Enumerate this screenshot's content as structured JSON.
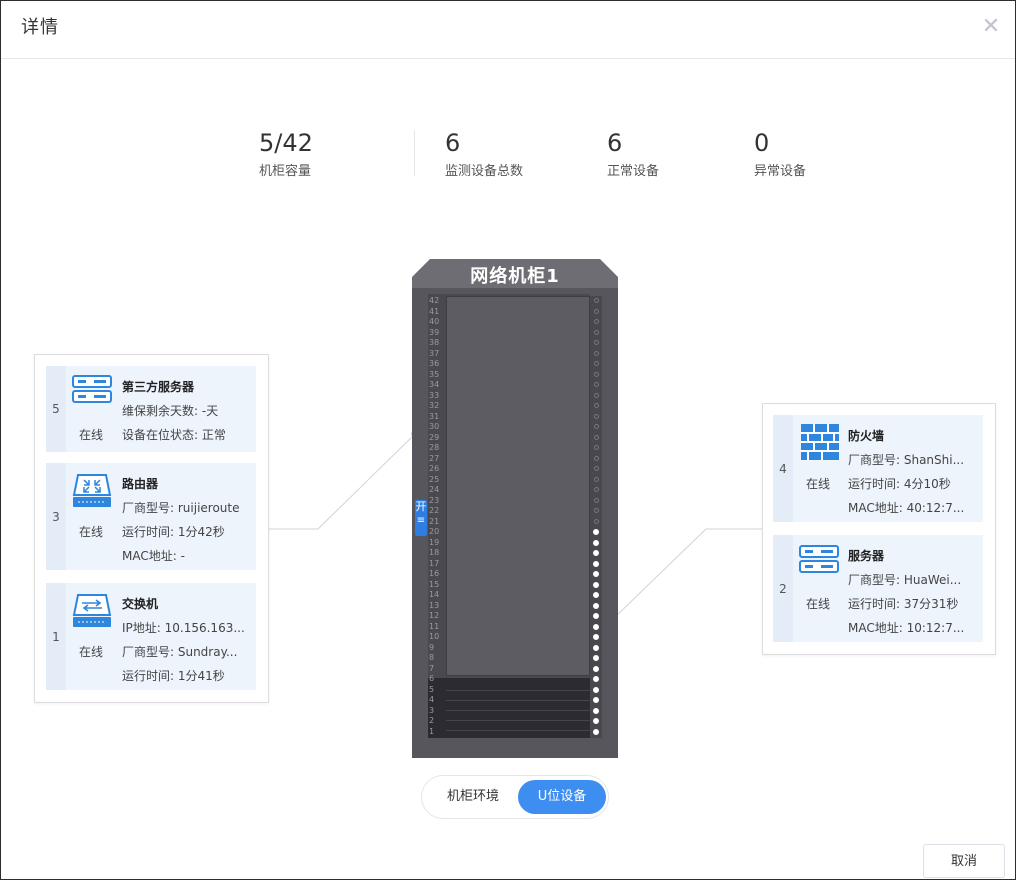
{
  "dialog": {
    "title": "详情",
    "close_icon": "close-icon",
    "cancel_label": "取消"
  },
  "stats": [
    {
      "value": "5/42",
      "label": "机柜容量"
    },
    {
      "value": "6",
      "label": "监测设备总数"
    },
    {
      "value": "6",
      "label": "正常设备"
    },
    {
      "value": "0",
      "label": "异常设备"
    }
  ],
  "cabinet": {
    "name": "网络机柜1",
    "side_button": "开",
    "side_icon": "list-icon",
    "units": [
      "42",
      "41",
      "40",
      "39",
      "38",
      "37",
      "36",
      "35",
      "34",
      "33",
      "32",
      "31",
      "30",
      "29",
      "28",
      "27",
      "26",
      "25",
      "24",
      "23",
      "22",
      "21",
      "20",
      "19",
      "18",
      "17",
      "16",
      "15",
      "14",
      "13",
      "12",
      "11",
      "10",
      "9",
      "8",
      "7",
      "6",
      "5",
      "4",
      "3",
      "2",
      "1"
    ]
  },
  "left_devices": [
    {
      "index": "5",
      "icon": "server-icon",
      "name": "第三方服务器",
      "status": "在线",
      "lines": [
        "维保剩余天数: -天",
        "设备在位状态: 正常"
      ]
    },
    {
      "index": "3",
      "icon": "router-icon",
      "name": "路由器",
      "status": "在线",
      "lines": [
        "厂商型号: ruijieroute",
        "运行时间: 1分42秒",
        "MAC地址: -"
      ]
    },
    {
      "index": "1",
      "icon": "switch-icon",
      "name": "交换机",
      "status": "在线",
      "lines": [
        "IP地址: 10.156.163...",
        "厂商型号: Sundray...",
        "运行时间: 1分41秒"
      ]
    }
  ],
  "right_devices": [
    {
      "index": "4",
      "icon": "firewall-icon",
      "name": "防火墙",
      "status": "在线",
      "lines": [
        "厂商型号: ShanShi...",
        "运行时间: 4分10秒",
        "MAC地址: 40:12:7..."
      ]
    },
    {
      "index": "2",
      "icon": "server-icon",
      "name": "服务器",
      "status": "在线",
      "lines": [
        "厂商型号: HuaWei...",
        "运行时间: 37分31秒",
        "MAC地址: 10:12:7..."
      ]
    }
  ],
  "view_toggle": {
    "options": [
      "机柜环境",
      "U位设备"
    ],
    "selected": "U位设备"
  },
  "colors": {
    "accent": "#3d8ef0",
    "card_bg": "#edf4fc",
    "cabinet": "#57565c"
  }
}
